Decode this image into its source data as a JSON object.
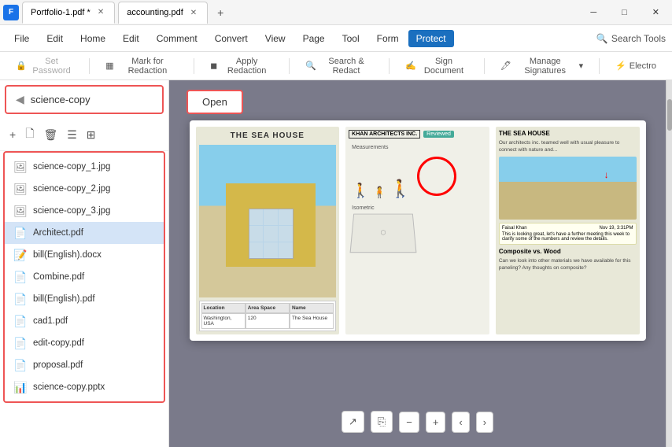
{
  "app": {
    "logo_text": "F",
    "tabs": [
      {
        "label": "Portfolio-1.pdf *",
        "active": true
      },
      {
        "label": "accounting.pdf",
        "active": false
      }
    ],
    "new_tab_symbol": "+",
    "win_controls": [
      "─",
      "□",
      "✕"
    ]
  },
  "menu": {
    "items": [
      "File",
      "Edit",
      "Home",
      "Edit",
      "Comment",
      "Convert",
      "View",
      "Page",
      "Tool",
      "Form",
      "Protect"
    ],
    "active": "Protect",
    "search_tools": "Search Tools"
  },
  "toolbar": {
    "set_password": "Set Password",
    "mark_redaction": "Mark for Redaction",
    "apply_redaction": "Apply Redaction",
    "search_redact": "Search & Redact",
    "sign_document": "Sign Document",
    "manage_signatures": "Manage Signatures",
    "electro": "Electro"
  },
  "sidebar": {
    "header_label": "science-copy",
    "tool_icons": [
      "+",
      "🗋",
      "🗑",
      "☰",
      "⊞"
    ],
    "files": [
      {
        "name": "science-copy_1.jpg",
        "type": "jpg"
      },
      {
        "name": "science-copy_2.jpg",
        "type": "jpg"
      },
      {
        "name": "science-copy_3.jpg",
        "type": "jpg"
      },
      {
        "name": "Architect.pdf",
        "type": "pdf",
        "selected": true
      },
      {
        "name": "bill(English).docx",
        "type": "docx"
      },
      {
        "name": "Combine.pdf",
        "type": "pdf"
      },
      {
        "name": "bill(English).pdf",
        "type": "pdf"
      },
      {
        "name": "cad1.pdf",
        "type": "pdf"
      },
      {
        "name": "edit-copy.pdf",
        "type": "pdf"
      },
      {
        "name": "proposal.pdf",
        "type": "pdf"
      },
      {
        "name": "science-copy.pptx",
        "type": "pptx"
      }
    ]
  },
  "content": {
    "open_button": "Open",
    "preview": {
      "left_title": "THE SEA HOUSE",
      "table_headers": [
        "Location",
        "Area Space",
        "Name"
      ],
      "center_top_left": "KHAN ARCHITECTS INC.",
      "reviewed": "Reviewed",
      "measurements": "Measurements",
      "isometric": "Isometric",
      "right_title": "THE SEA HOUSE",
      "right_comment_name": "Faisal Khan",
      "right_comment_date": "Nov 19, 3:31PM",
      "right_comment_text": "This is looking great, let's have a further meeting this week to clarify some of the numbers and review the details.",
      "composite_title": "Composite vs. Wood",
      "composite_text": "Can we look into other materials we have available for this paneling? Any thoughts on composite?"
    }
  },
  "bottom_bar": {
    "export_icon": "↗",
    "save_icon": "⎘",
    "zoom_out": "−",
    "zoom_in": "+",
    "prev_page": "‹",
    "next_page": "›"
  }
}
